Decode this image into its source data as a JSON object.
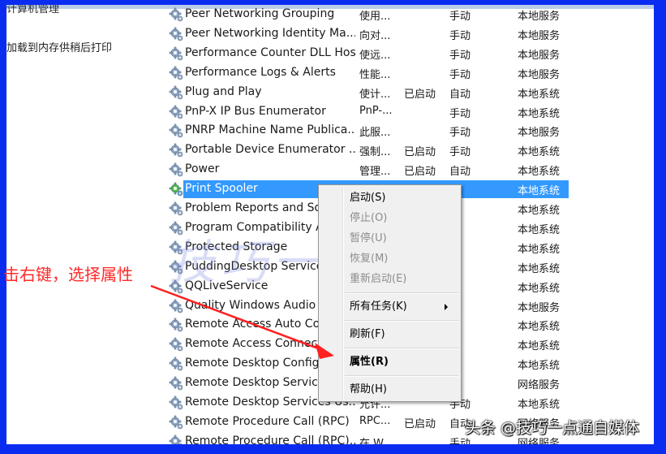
{
  "left_pane": {
    "title_partial": "计算机管理",
    "description_partial": "加载到内存供稍后打印"
  },
  "services": [
    {
      "name": "Peer Networking Grouping",
      "description": "使用...",
      "status": "",
      "startup": "手动",
      "logon": "本地服务"
    },
    {
      "name": "Peer Networking Identity Ma...",
      "description": "向对...",
      "status": "",
      "startup": "手动",
      "logon": "本地服务"
    },
    {
      "name": "Performance Counter DLL Host",
      "description": "使远...",
      "status": "",
      "startup": "手动",
      "logon": "本地服务"
    },
    {
      "name": "Performance Logs & Alerts",
      "description": "性能...",
      "status": "",
      "startup": "手动",
      "logon": "本地服务"
    },
    {
      "name": "Plug and Play",
      "description": "使计...",
      "status": "已启动",
      "startup": "自动",
      "logon": "本地系统"
    },
    {
      "name": "PnP-X IP Bus Enumerator",
      "description": "PnP-...",
      "status": "",
      "startup": "手动",
      "logon": "本地系统"
    },
    {
      "name": "PNRP Machine Name Publica...",
      "description": "此服...",
      "status": "",
      "startup": "手动",
      "logon": "本地服务"
    },
    {
      "name": "Portable Device Enumerator ...",
      "description": "强制...",
      "status": "已启动",
      "startup": "手动",
      "logon": "本地系统"
    },
    {
      "name": "Power",
      "description": "管理...",
      "status": "已启动",
      "startup": "自动",
      "logon": "本地系统"
    },
    {
      "name": "Print Spooler",
      "description": "",
      "status": "",
      "startup": "动",
      "logon": "本地系统",
      "selected": true
    },
    {
      "name": "Problem Reports and So",
      "description": "",
      "status": "",
      "startup": "动",
      "logon": "本地系统"
    },
    {
      "name": "Program Compatibility A",
      "description": "",
      "status": "",
      "startup": "动",
      "logon": "本地系统"
    },
    {
      "name": "Protected Storage",
      "description": "",
      "status": "",
      "startup": "动",
      "logon": "本地系统"
    },
    {
      "name": "PuddingDesktop Service",
      "description": "",
      "status": "",
      "startup": "动",
      "logon": "本地系统"
    },
    {
      "name": "QQLiveService",
      "description": "",
      "status": "",
      "startup": "动",
      "logon": "本地系统"
    },
    {
      "name": "Quality Windows Audio V",
      "description": "",
      "status": "",
      "startup": "动",
      "logon": "本地服务"
    },
    {
      "name": "Remote Access Auto Con",
      "description": "",
      "status": "",
      "startup": "动",
      "logon": "本地系统"
    },
    {
      "name": "Remote Access Connectio",
      "description": "",
      "status": "",
      "startup": "动",
      "logon": "本地系统"
    },
    {
      "name": "Remote Desktop Configu",
      "description": "",
      "status": "",
      "startup": "动",
      "logon": "本地系统"
    },
    {
      "name": "Remote Desktop Service",
      "description": "",
      "status": "",
      "startup": "动",
      "logon": "网络服务"
    },
    {
      "name": "Remote Desktop Services Us...",
      "description": "允许...",
      "status": "",
      "startup": "手动",
      "logon": "本地系统"
    },
    {
      "name": "Remote Procedure Call (RPC)",
      "description": "RPC...",
      "status": "已启动",
      "startup": "自动",
      "logon": "网络服务"
    },
    {
      "name": "Remote Procedure Call (RPC)...",
      "description": "在 W...",
      "status": "",
      "startup": "手动",
      "logon": "网络服务"
    }
  ],
  "context_menu": {
    "items": [
      {
        "label": "启动(S)",
        "disabled": false
      },
      {
        "label": "停止(O)",
        "disabled": true
      },
      {
        "label": "暂停(U)",
        "disabled": true
      },
      {
        "label": "恢复(M)",
        "disabled": true
      },
      {
        "label": "重新启动(E)",
        "disabled": true
      },
      {
        "label": "所有任务(K)",
        "disabled": false,
        "submenu": true
      },
      {
        "label": "刷新(F)",
        "disabled": false
      },
      {
        "label": "属性(R)",
        "disabled": false,
        "bold": true
      },
      {
        "label": "帮助(H)",
        "disabled": false
      }
    ]
  },
  "annotation": {
    "text": "击右键，选择属性",
    "color": "#ff2a2a"
  },
  "watermark": {
    "center_text": "技巧一点通",
    "footer_text": "头条 @技巧一点通自媒体"
  },
  "colors": {
    "frame_border": "#0a2cf0",
    "selection": "#3399ff"
  }
}
